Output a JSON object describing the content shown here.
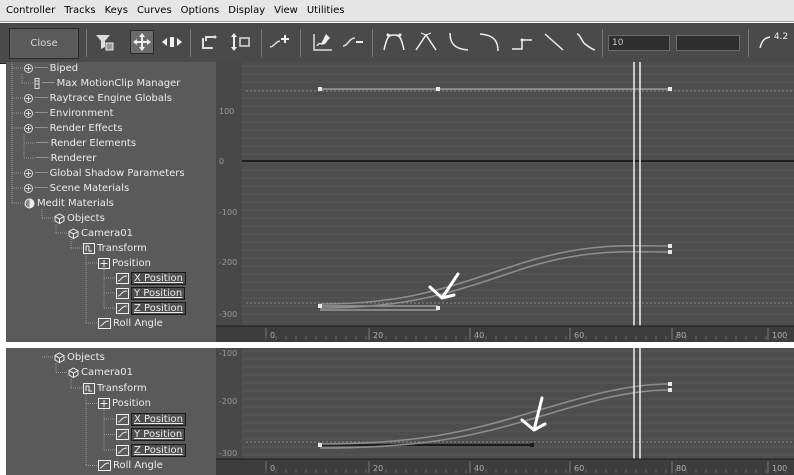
{
  "menu": [
    "Controller",
    "Tracks",
    "Keys",
    "Curves",
    "Options",
    "Display",
    "View",
    "Utilities"
  ],
  "toolbar": {
    "close_label": "Close",
    "field_value": "10",
    "field2_value": "",
    "readout": "4.2",
    "icons": [
      "filter-icon",
      "move-keys-icon",
      "slide-keys-icon",
      "scale-keys-icon",
      "scale-values-icon",
      "add-keys-icon",
      "draw-curves-icon",
      "reduce-keys-icon",
      "tangent-auto-icon",
      "tangent-custom-icon",
      "tangent-fast-icon",
      "tangent-slow-icon",
      "tangent-step-icon",
      "tangent-linear-icon",
      "tangent-smooth-icon"
    ]
  },
  "top": {
    "tree": [
      {
        "label": "Biped",
        "icon": "expand-icon"
      },
      {
        "label": "Max MotionClip Manager",
        "icon": "clip-icon"
      },
      {
        "label": "Raytrace Engine Globals",
        "icon": "expand-icon"
      },
      {
        "label": "Environment",
        "icon": "expand-icon"
      },
      {
        "label": "Render Effects",
        "icon": "expand-icon"
      },
      {
        "label": "Render Elements",
        "icon": ""
      },
      {
        "label": "Renderer",
        "icon": ""
      },
      {
        "label": "Global Shadow Parameters",
        "icon": "expand-icon"
      },
      {
        "label": "Scene Materials",
        "icon": "expand-icon"
      },
      {
        "label": "Medit Materials",
        "icon": "material-icon"
      },
      {
        "label": "Objects",
        "icon": "objects-icon"
      },
      {
        "label": "Camera01",
        "icon": "object-icon"
      },
      {
        "label": "Transform",
        "icon": "transform-icon"
      },
      {
        "label": "Position",
        "icon": "position-icon"
      },
      {
        "label": "X Position",
        "icon": "curve-icon"
      },
      {
        "label": "Y Position",
        "icon": "curve-icon"
      },
      {
        "label": "Z Position",
        "icon": "curve-icon"
      },
      {
        "label": "Roll Angle",
        "icon": "curve-icon"
      }
    ],
    "y_ticks": [
      "100",
      "0",
      "-100",
      "-200",
      "-300"
    ],
    "x_ticks": [
      "0",
      "20",
      "40",
      "60",
      "80",
      "100"
    ]
  },
  "bottom": {
    "tree": [
      {
        "label": "Objects",
        "icon": "objects-icon"
      },
      {
        "label": "Camera01",
        "icon": "object-icon"
      },
      {
        "label": "Transform",
        "icon": "transform-icon"
      },
      {
        "label": "Position",
        "icon": "position-icon"
      },
      {
        "label": "X Position",
        "icon": "curve-icon"
      },
      {
        "label": "Y Position",
        "icon": "curve-icon"
      },
      {
        "label": "Z Position",
        "icon": "curve-icon"
      },
      {
        "label": "Roll Angle",
        "icon": "curve-icon"
      }
    ],
    "y_ticks": [
      "-100",
      "-200",
      "-300"
    ],
    "x_ticks": [
      "0",
      "20",
      "40",
      "60",
      "80",
      "100"
    ]
  },
  "colors": {
    "graph_bg": "#4d4d4d",
    "curve": "#8a8a8a",
    "time_slider": "#f0f0f0",
    "key": "#e8e8e8"
  }
}
